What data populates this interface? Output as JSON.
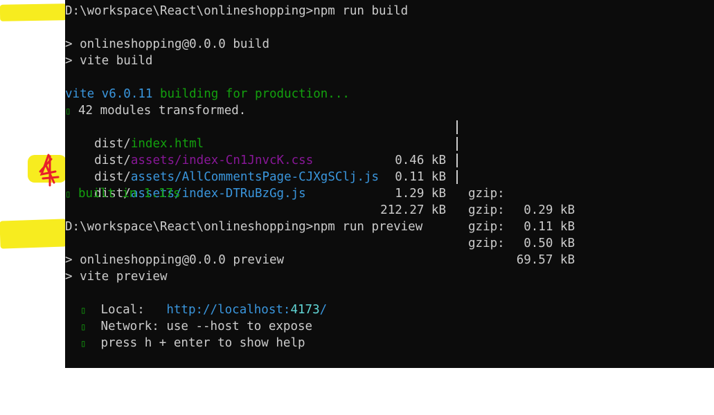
{
  "lines": {
    "prompt1": "D:\\workspace\\React\\onlineshopping>npm run build",
    "script1": "> onlineshopping@0.0.0 build",
    "script2": "> vite build",
    "vite_version": "vite v6.0.11",
    "building": " building for production...",
    "modules_icon": "▯",
    "modules": " 42 modules transformed.",
    "built_icon": "▯",
    "built": " built in 1.17s",
    "prompt2": "D:\\workspace\\React\\onlineshopping>npm run preview",
    "script3": "> onlineshopping@0.0.0 preview",
    "script4": "> vite preview",
    "local_icon": "▯",
    "local_label": "Local:",
    "local_url_base": "http://localhost:",
    "local_url_port": "4173",
    "local_url_tail": "/",
    "network_icon": "▯",
    "network_text": "Network: use --host to expose",
    "help_icon": "▯",
    "help_text": "press h + enter to show help"
  },
  "files": [
    {
      "prefix": "dist/",
      "name": "index.html",
      "size": "0.46 kB",
      "gzip_label": "gzip:",
      "gzip": "0.29 kB"
    },
    {
      "prefix": "dist/",
      "name": "assets/index-Cn1JnvcK.css",
      "size": "0.11 kB",
      "gzip_label": "gzip:",
      "gzip": "0.11 kB"
    },
    {
      "prefix": "dist/",
      "name": "assets/AllCommentsPage-CJXgSClj.js",
      "size": "1.29 kB",
      "gzip_label": "gzip:",
      "gzip": "0.50 kB"
    },
    {
      "prefix": "dist/",
      "name": "assets/index-DTRuBzGg.js",
      "size": "212.27 kB",
      "gzip_label": "gzip:",
      "gzip": "69.57 kB"
    }
  ],
  "colors": {
    "background": "#0c0c0c",
    "text": "#cccccc",
    "blue": "#3a96dd",
    "green": "#13a10e",
    "magenta": "#881798",
    "highlight": "#f7ec1f",
    "scribble": "#e8202a"
  }
}
